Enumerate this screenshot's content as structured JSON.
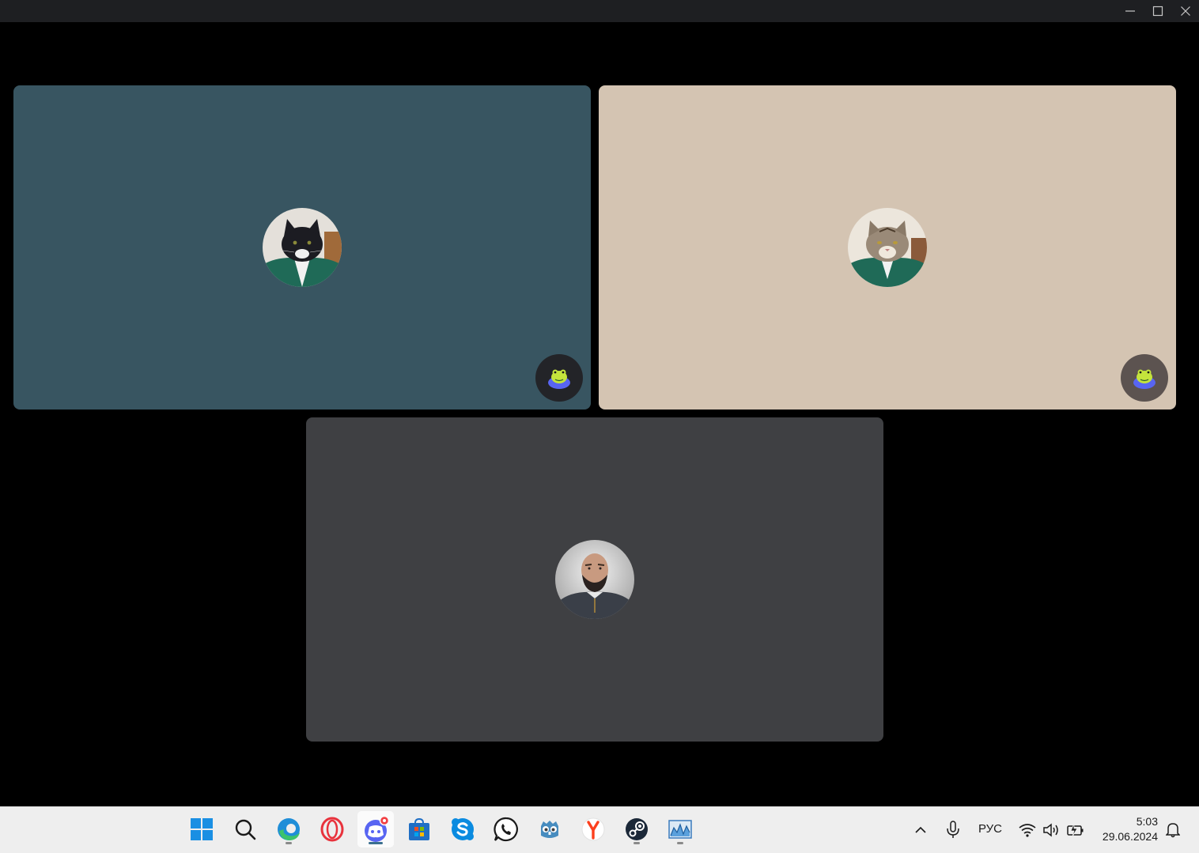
{
  "window": {
    "controls": [
      "minimize",
      "maximize",
      "close"
    ]
  },
  "call": {
    "tiles": [
      {
        "avatar": "black-cat-avatar",
        "bg": "#385561",
        "badge_bg": "#232428"
      },
      {
        "avatar": "tabby-cat-avatar",
        "bg": "#d4c4b2",
        "badge_bg": "#5c5350"
      },
      {
        "avatar": "bearded-man-avatar",
        "bg": "#3f4043"
      }
    ],
    "badge_icon": "frog-on-disc-icon"
  },
  "taskbar": {
    "apps": [
      "start",
      "search",
      "edge",
      "opera",
      "discord",
      "microsoft-store",
      "skype",
      "whatsapp",
      "godot",
      "yandex-browser",
      "steam",
      "system-monitor"
    ],
    "active_app": "discord",
    "discord_badge_color": "#f23f43",
    "language": "РУС",
    "time": "5:03",
    "date": "29.06.2024"
  }
}
